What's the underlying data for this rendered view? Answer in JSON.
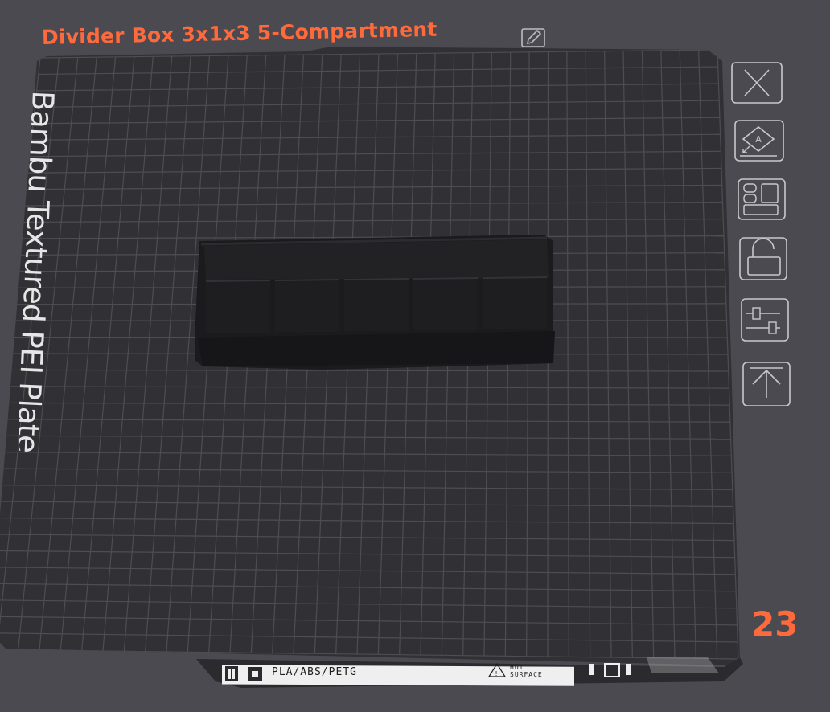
{
  "header": {
    "title": "Divider Box 3x1x3 5-Compartment",
    "edit_icon": "pencil-edit-icon"
  },
  "plate": {
    "name": "Bambu Textured PEI Plate",
    "number": "23"
  },
  "label_strip": {
    "materials": "PLA/ABS/PETG",
    "warning_line1": "HOT",
    "warning_line2": "SURFACE"
  },
  "toolbar": {
    "icons": [
      "close-icon",
      "auto-orient-icon",
      "arrange-icon",
      "lock-icon",
      "plate-settings-icon",
      "move-to-top-icon"
    ]
  },
  "colors": {
    "accent": "#ff6a3d",
    "background": "#4a4a50",
    "plate": "#313135",
    "grid": "#505056",
    "model": "#1c1c1e"
  }
}
